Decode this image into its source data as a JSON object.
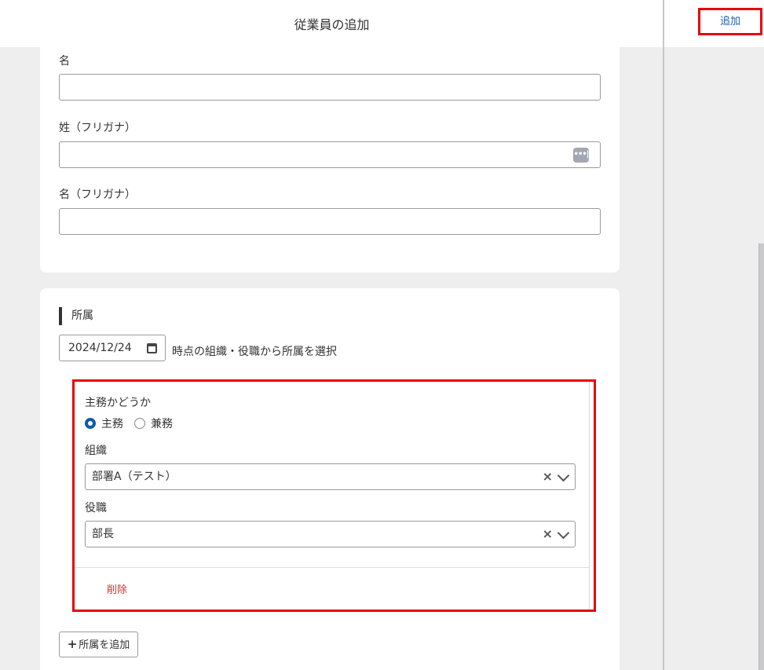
{
  "header": {
    "title": "従業員の追加",
    "add_label": "追加"
  },
  "personal": {
    "first_name_label": "名",
    "last_name_kana_label": "姓（フリガナ）",
    "first_name_kana_label": "名（フリガナ）",
    "first_name_value": "",
    "last_name_kana_value": "",
    "first_name_kana_value": ""
  },
  "affiliation": {
    "section_title": "所属",
    "date_value": "2024/12/24",
    "date_suffix": "時点の組織・役職から所属を選択",
    "primary_label": "主務かどうか",
    "radio_options": [
      "主務",
      "兼務"
    ],
    "radio_selected": "主務",
    "org_label": "組織",
    "org_value": "部署A（テスト）",
    "role_label": "役職",
    "role_value": "部長",
    "delete_label": "削除",
    "add_affiliation_label": "所属を追加"
  },
  "icons": {
    "password_manager": "dots-icon",
    "calendar": "calendar-icon",
    "clear": "clear-icon",
    "dropdown": "chevron-down-icon",
    "plus": "plus-icon"
  },
  "colors": {
    "highlight": "#e8000a",
    "link_blue": "#1b5fa7",
    "radio_blue": "#0b5cab",
    "delete_red": "#c23934",
    "background": "#eeeeef"
  }
}
